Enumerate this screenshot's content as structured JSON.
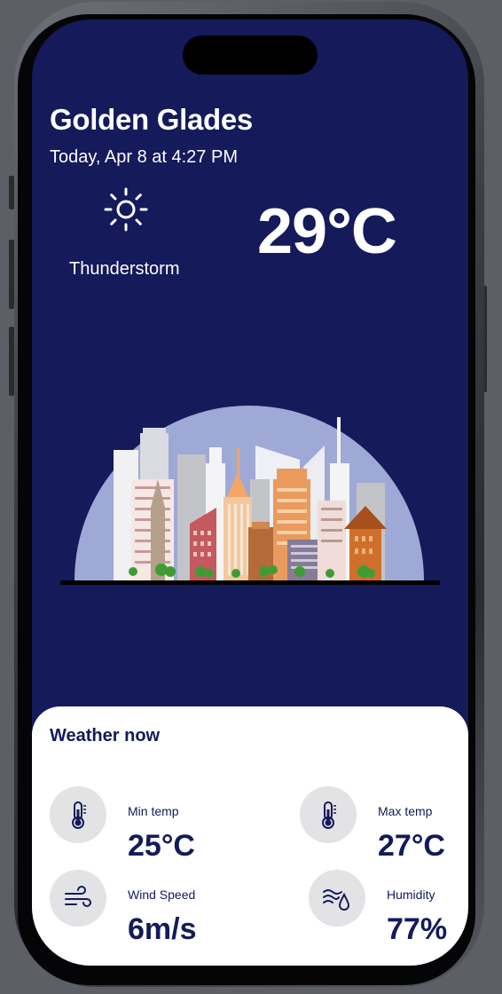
{
  "location": {
    "city": "Golden Glades",
    "datetime": "Today, Apr 8 at 4:27 PM"
  },
  "current": {
    "condition": "Thunderstorm",
    "temperature": "29°C",
    "icon": "sun-icon"
  },
  "weather_now": {
    "title": "Weather now",
    "min_temp": {
      "label": "Min temp",
      "value": "25°C",
      "icon": "thermometer-icon"
    },
    "max_temp": {
      "label": "Max temp",
      "value": "27°C",
      "icon": "thermometer-icon"
    },
    "wind_speed": {
      "label": "Wind Speed",
      "value": "6m/s",
      "icon": "wind-icon"
    },
    "humidity": {
      "label": "Humidity",
      "value": "77%",
      "icon": "humidity-icon"
    }
  },
  "colors": {
    "background": "#141a5a",
    "panel": "#ffffff",
    "accent_text": "#141a5a",
    "icon_circle": "#e3e3e6",
    "sky_dome": "#9fa9d6"
  }
}
